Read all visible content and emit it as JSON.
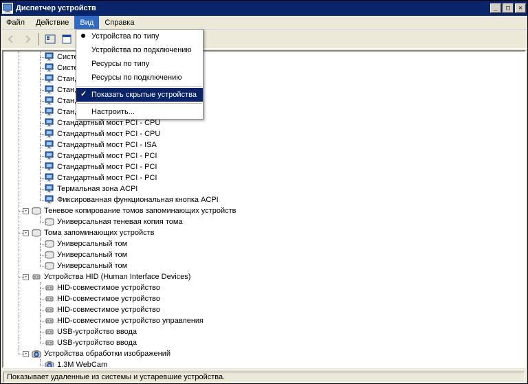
{
  "window": {
    "title": "Диспетчер устройств"
  },
  "menubar": {
    "items": [
      {
        "label": "Файл"
      },
      {
        "label": "Действие"
      },
      {
        "label": "Вид",
        "active": true
      },
      {
        "label": "Справка"
      }
    ]
  },
  "view_menu": {
    "items": [
      {
        "label": "Устройства по типу",
        "radio": true
      },
      {
        "label": "Устройства по подключению"
      },
      {
        "label": "Ресурсы по типу"
      },
      {
        "label": "Ресурсы по подключению"
      },
      {
        "sep": true
      },
      {
        "label": "Показать скрытые устройства",
        "checked": true,
        "highlighted": true
      },
      {
        "sep": true
      },
      {
        "label": "Настроить..."
      }
    ]
  },
  "tree": {
    "nodes": [
      {
        "depth": 2,
        "icon": "monitor",
        "label": "Систе",
        "conn": "tee"
      },
      {
        "depth": 2,
        "icon": "monitor",
        "label": "Систе",
        "conn": "tee"
      },
      {
        "depth": 2,
        "icon": "monitor",
        "label": "Стан,",
        "conn": "tee"
      },
      {
        "depth": 2,
        "icon": "monitor",
        "label": "Стан,",
        "conn": "tee"
      },
      {
        "depth": 2,
        "icon": "monitor",
        "label": "Стан,",
        "conn": "tee"
      },
      {
        "depth": 2,
        "icon": "monitor",
        "label": "Стан,",
        "conn": "tee"
      },
      {
        "depth": 2,
        "icon": "monitor",
        "label": "Стандартный мост PCI  - CPU",
        "conn": "tee"
      },
      {
        "depth": 2,
        "icon": "monitor",
        "label": "Стандартный мост PCI  - CPU",
        "conn": "tee"
      },
      {
        "depth": 2,
        "icon": "monitor",
        "label": "Стандартный мост PCI - ISA",
        "conn": "tee"
      },
      {
        "depth": 2,
        "icon": "monitor",
        "label": "Стандартный мост PCI - PCI",
        "conn": "tee"
      },
      {
        "depth": 2,
        "icon": "monitor",
        "label": "Стандартный мост PCI - PCI",
        "conn": "tee"
      },
      {
        "depth": 2,
        "icon": "monitor",
        "label": "Стандартный мост PCI - PCI",
        "conn": "tee"
      },
      {
        "depth": 2,
        "icon": "monitor",
        "label": "Термальная зона ACPI",
        "conn": "tee"
      },
      {
        "depth": 2,
        "icon": "monitor",
        "label": "Фиксированная функциональная кнопка ACPI",
        "conn": "el"
      },
      {
        "depth": 1,
        "icon": "drive",
        "label": "Теневое копирование томов запоминающих устройств",
        "conn": "tee",
        "expander": "-"
      },
      {
        "depth": 2,
        "icon": "drive",
        "label": "Универсальная теневая копия тома",
        "conn": "el"
      },
      {
        "depth": 1,
        "icon": "drive",
        "label": "Тома запоминающих устройств",
        "conn": "tee",
        "expander": "-"
      },
      {
        "depth": 2,
        "icon": "drive",
        "label": "Универсальный том",
        "conn": "tee"
      },
      {
        "depth": 2,
        "icon": "drive",
        "label": "Универсальный том",
        "conn": "tee"
      },
      {
        "depth": 2,
        "icon": "drive",
        "label": "Универсальный том",
        "conn": "el"
      },
      {
        "depth": 1,
        "icon": "hid",
        "label": "Устройства HID (Human Interface Devices)",
        "conn": "tee",
        "expander": "-"
      },
      {
        "depth": 2,
        "icon": "hid",
        "label": "HID-совместимое устройство",
        "conn": "tee"
      },
      {
        "depth": 2,
        "icon": "hid",
        "label": "HID-совместимое устройство",
        "conn": "tee"
      },
      {
        "depth": 2,
        "icon": "hid",
        "label": "HID-совместимое устройство",
        "conn": "tee"
      },
      {
        "depth": 2,
        "icon": "hid",
        "label": "HID-совместимое устройство управления",
        "conn": "tee"
      },
      {
        "depth": 2,
        "icon": "hid",
        "label": "USB-устройство ввода",
        "conn": "tee"
      },
      {
        "depth": 2,
        "icon": "hid",
        "label": "USB-устройство ввода",
        "conn": "el"
      },
      {
        "depth": 1,
        "icon": "camera",
        "label": "Устройства обработки изображений",
        "conn": "el",
        "expander": "-"
      },
      {
        "depth": 2,
        "icon": "camera",
        "label": "1.3M WebCam",
        "conn": "el",
        "noParentLine": true
      }
    ]
  },
  "statusbar": {
    "text": "Показывает удаленные из системы и устаревшие устройства."
  }
}
